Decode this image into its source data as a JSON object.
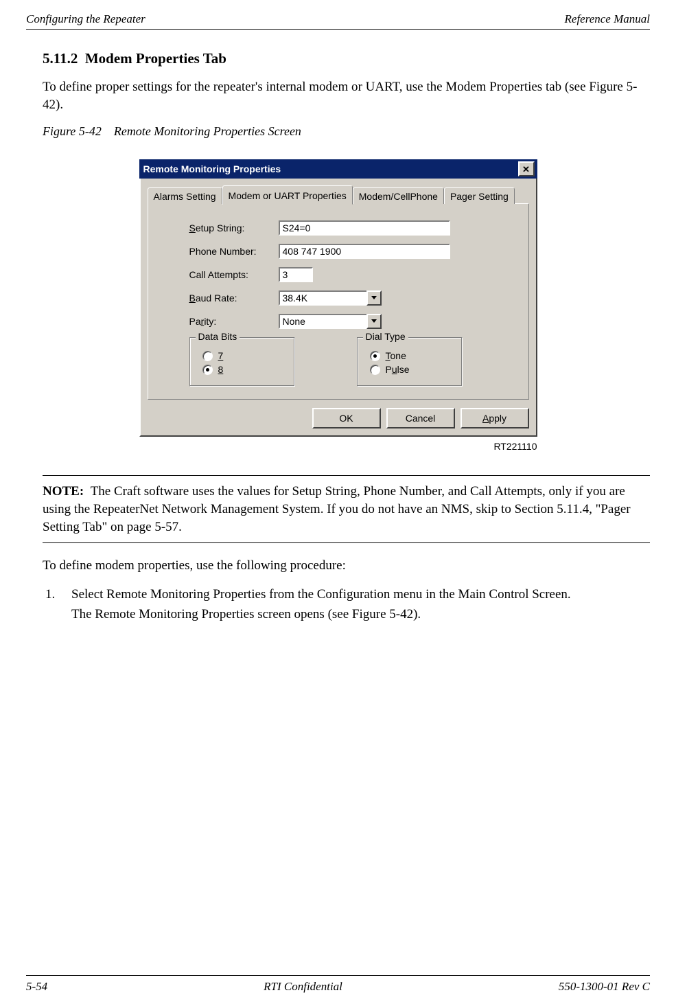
{
  "header": {
    "left": "Configuring the Repeater",
    "right": "Reference Manual"
  },
  "section": {
    "number": "5.11.2",
    "title": "Modem Properties Tab"
  },
  "intro": "To define proper settings for the repeater's internal modem or UART, use the Modem Properties tab (see Figure 5-42).",
  "figure_caption": {
    "label": "Figure 5-42",
    "text": "Remote Monitoring Properties Screen"
  },
  "dialog": {
    "title": "Remote Monitoring Properties",
    "close_glyph": "✕",
    "tabs": [
      "Alarms Setting",
      "Modem or UART Properties",
      "Modem/CellPhone",
      "Pager Setting"
    ],
    "fields": {
      "setup_string": {
        "label_pre": "S",
        "label_post": "etup String:",
        "value": "S24=0"
      },
      "phone_number": {
        "label": "Phone Number:",
        "value": "408 747 1900"
      },
      "call_attempts": {
        "label": "Call Attempts:",
        "value": "3"
      },
      "baud_rate": {
        "label_pre": "B",
        "label_post": "aud Rate:",
        "value": "38.4K"
      },
      "parity": {
        "label_pre": "P",
        "label_post": "arity:",
        "value": "None"
      }
    },
    "data_bits": {
      "title": "Data Bits",
      "options": [
        {
          "label": "7",
          "selected": false
        },
        {
          "label": "8",
          "selected": true
        }
      ]
    },
    "dial_type": {
      "title": "Dial Type",
      "options": [
        {
          "label_pre": "T",
          "label_post": "one",
          "selected": true
        },
        {
          "label_pre": "P",
          "label_post": "ulse",
          "selected": false
        }
      ]
    },
    "buttons": {
      "ok": "OK",
      "cancel": "Cancel",
      "apply_pre": "A",
      "apply_post": "pply"
    }
  },
  "image_id": "RT221110",
  "note": {
    "label": "NOTE:",
    "text": "The Craft software uses the values for Setup String, Phone Number, and Call Attempts, only if you are using the RepeaterNet Network Management System. If you do not have an NMS, skip to Section 5.11.4, \"Pager Setting Tab\" on page 5-57."
  },
  "proc_intro": "To define modem properties, use the following procedure:",
  "steps": {
    "s1": "Select Remote Monitoring Properties from the Configuration menu in the Main Control Screen.",
    "s1_sub": "The Remote Monitoring Properties screen opens (see Figure 5-42)."
  },
  "footer": {
    "left": "5-54",
    "center": "RTI Confidential",
    "right": "550-1300-01 Rev C"
  }
}
